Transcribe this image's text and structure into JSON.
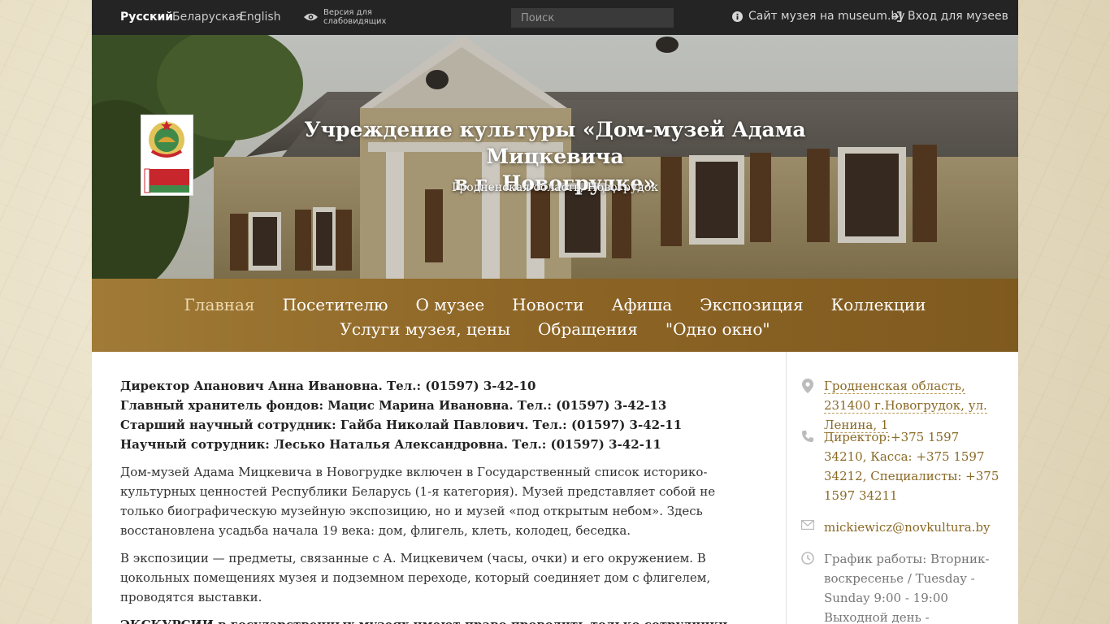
{
  "topbar": {
    "languages": [
      "Русский",
      "Беларуская",
      "English"
    ],
    "vision_line1": "Версия для",
    "vision_line2": "слабовидящих",
    "search_placeholder": "Поиск",
    "museum_site": "Сайт музея на museum.by",
    "login": "Вход для музеев"
  },
  "hero": {
    "title_line1": "Учреждение культуры «Дом-музей Адама Мицкевича",
    "title_line2": "в г. Новогрудке»",
    "subtitle": "Гродненская область, Новогрудок"
  },
  "nav": {
    "row1": [
      "Главная",
      "Посетителю",
      "О музее",
      "Новости",
      "Афиша",
      "Экспозиция",
      "Коллекции"
    ],
    "row2": [
      "Услуги музея, цены",
      "Обращения",
      "\"Одно окно\""
    ]
  },
  "main": {
    "contacts": [
      "Директор Апанович Анна Ивановна. Тел.: (01597) 3-42-10",
      "Главный хранитель фондов: Мацис Марина Ивановна. Тел.: (01597) 3-42-13",
      "Старший научный сотрудник: Гайба Николай Павлович. Тел.: (01597) 3-42-11",
      "Научный сотрудник: Лесько Наталья Александровна. Тел.: (01597) 3-42-11"
    ],
    "para1": "Дом-музей Адама Мицкевича в Новогрудке включен в Государственный список историко-культурных ценностей Республики Беларусь (1-я категория). Музей представляет собой не только биографическую музейную экспозицию, но и музей «под открытым небом». Здесь восстановлена усадьба начала 19 века: дом, флигель, клеть, колодец, беседка.",
    "para2": "В экспозиции — предметы, связанные с А. Мицкевичем (часы, очки) и его окружением. В цокольных помещениях музея и подземном переходе, который соединяет дом с флигелем, проводятся выставки.",
    "para3": "ЭКСКУРСИИ в государственных музеях имеют право проводить только сотрудники этих музеев."
  },
  "sidebar": {
    "address": "Гродненская область, 231400 г.Новогрудок, ул. Ленина, 1",
    "phones": "Директор:+375 1597 34210, Касса: +375 1597 34212, Специалисты: +375 1597 34211",
    "email": "mickiewicz@novkultura.by",
    "schedule": "График работы: Вторник- воскресенье / Tuesday - Sunday 9:00 - 19:00 Выходной день -"
  },
  "colors": {
    "accent": "#8a6a26",
    "nav_bg": "#8c6425",
    "topbar_bg": "#242424"
  }
}
